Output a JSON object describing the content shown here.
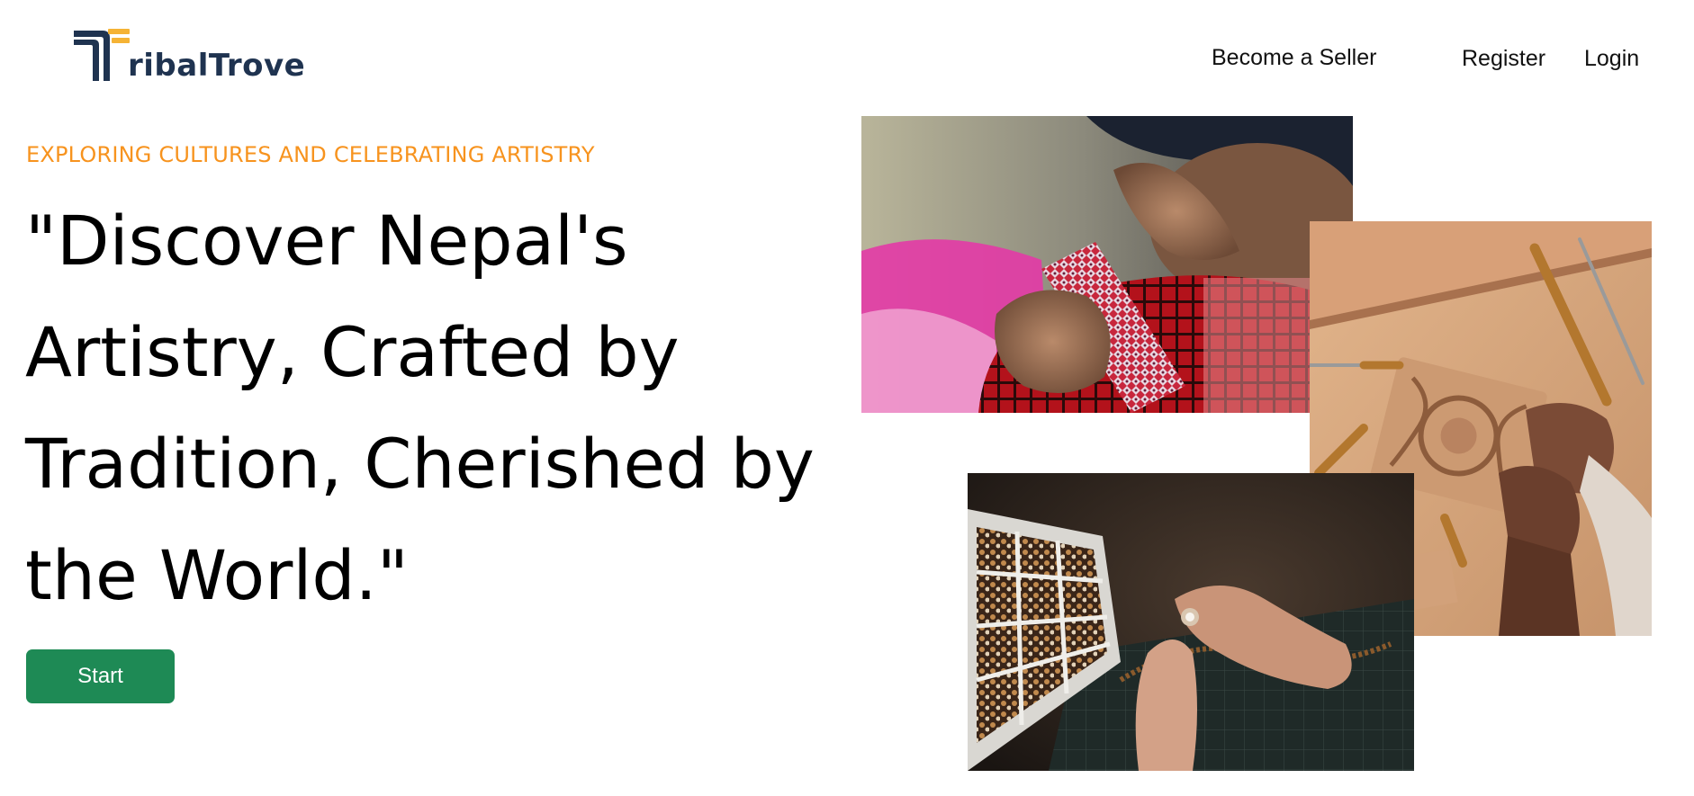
{
  "header": {
    "logo_text": "ribalTrove",
    "logo_lettering": "TribalTrove",
    "nav": {
      "seller": "Become a Seller",
      "register": "Register",
      "login": "Login"
    }
  },
  "hero": {
    "tagline": "EXPLORING CULTURES AND CELEBRATING ARTISTRY",
    "headline": "\"Discover Nepal's Artistry, Crafted by Tradition, Cherished by the World.\"",
    "cta_label": "Start"
  },
  "colors": {
    "brand_navy": "#1f3350",
    "brand_gold": "#f5b335",
    "tagline_orange": "#f7931e",
    "cta_green": "#1e8a55"
  },
  "gallery": {
    "items": [
      {
        "name": "weaving-photo"
      },
      {
        "name": "wood-carving-photo"
      },
      {
        "name": "beadwork-photo"
      }
    ]
  }
}
